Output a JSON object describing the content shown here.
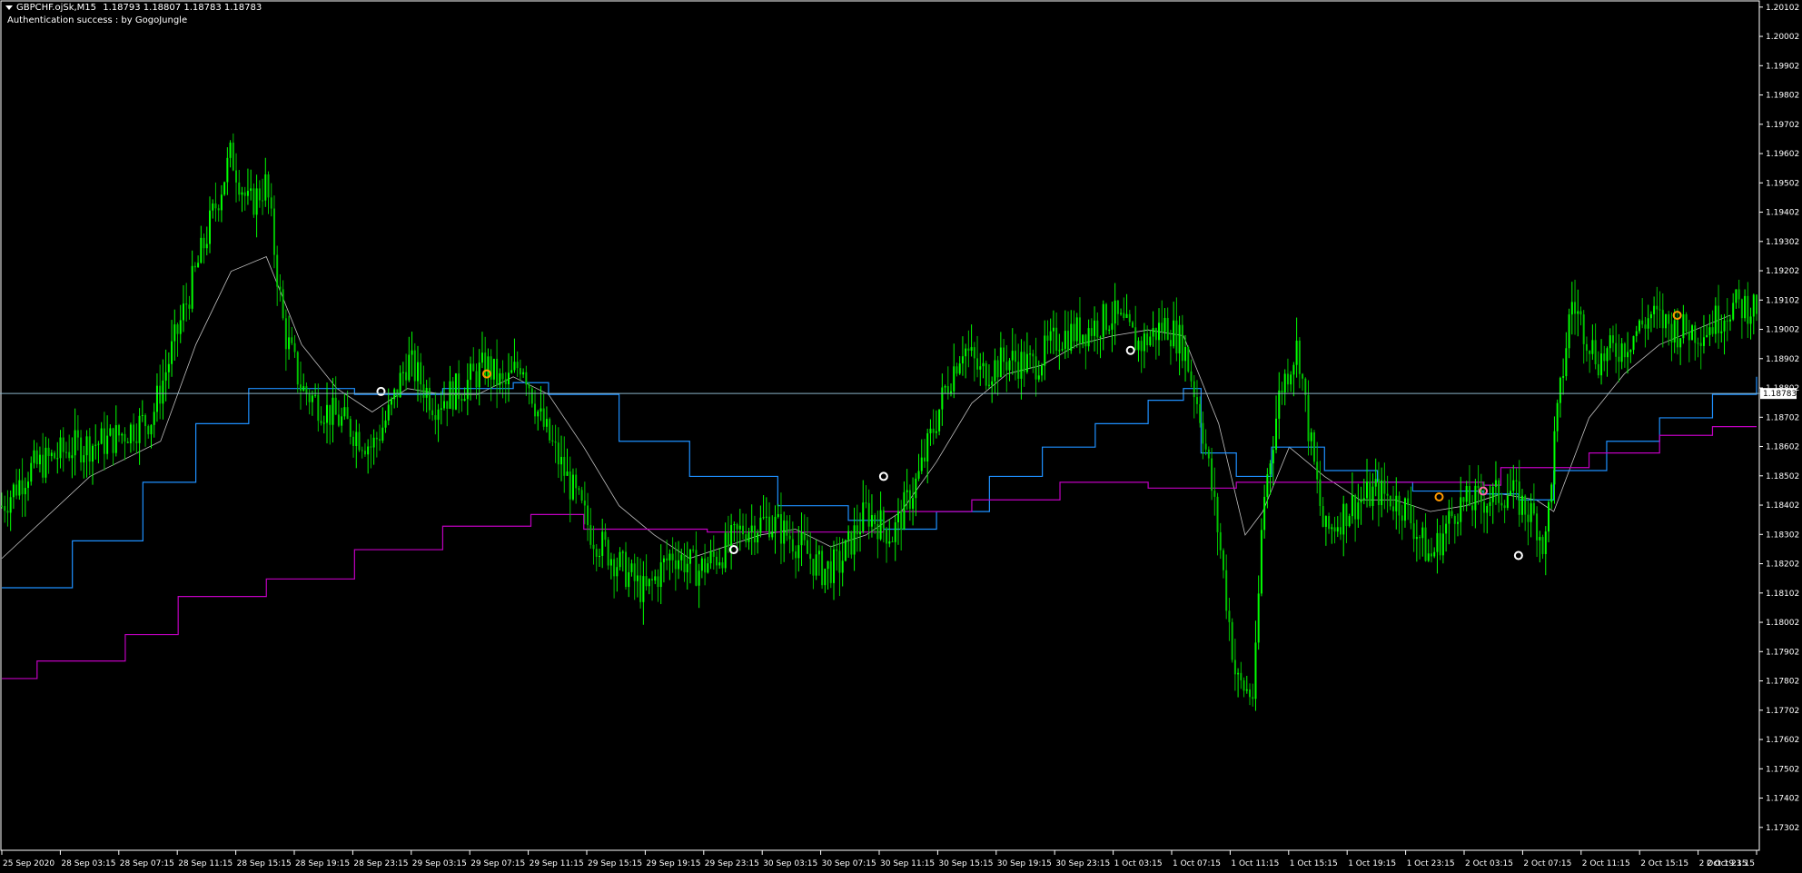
{
  "header": {
    "symbol_tf": "GBPCHF.ojSk,M15",
    "open": "1.18793",
    "high": "1.18807",
    "low": "1.18783",
    "close": "1.18783",
    "auth_message": "Authentication success : by GogoJungle"
  },
  "colors": {
    "background": "#000000",
    "axis": "#ffffff",
    "bull_candle": "#00ff00",
    "bear_candle": "#00c000",
    "ma_fast": "#c0c0c0",
    "ma_blue": "#1e90ff",
    "ma_magenta": "#c000c0",
    "bid_line": "#8ab4c8",
    "signal_white": "#ffffff",
    "signal_orange": "#ff9900",
    "signal_pink": "#ff66aa"
  },
  "chart_data": {
    "type": "candlestick",
    "title": "GBPCHF.ojSk,M15",
    "price_labels": [
      "1.20102",
      "1.20002",
      "1.19902",
      "1.19802",
      "1.19702",
      "1.19602",
      "1.19502",
      "1.19402",
      "1.19302",
      "1.19202",
      "1.19102",
      "1.19002",
      "1.18902",
      "1.18802",
      "1.18702",
      "1.18602",
      "1.18502",
      "1.18402",
      "1.18302",
      "1.18202",
      "1.18102",
      "1.18002",
      "1.17902",
      "1.17802",
      "1.17702",
      "1.17602",
      "1.17502",
      "1.17402",
      "1.17302"
    ],
    "ylim": [
      1.1723,
      1.2012
    ],
    "current_price": "1.18783",
    "time_labels": [
      "25 Sep 2020",
      "28 Sep 03:15",
      "28 Sep 07:15",
      "28 Sep 11:15",
      "28 Sep 15:15",
      "28 Sep 19:15",
      "28 Sep 23:15",
      "29 Sep 03:15",
      "29 Sep 07:15",
      "29 Sep 11:15",
      "29 Sep 15:15",
      "29 Sep 19:15",
      "29 Sep 23:15",
      "30 Sep 03:15",
      "30 Sep 07:15",
      "30 Sep 11:15",
      "30 Sep 15:15",
      "30 Sep 19:15",
      "30 Sep 23:15",
      "1 Oct 03:15",
      "1 Oct 07:15",
      "1 Oct 11:15",
      "1 Oct 15:15",
      "1 Oct 19:15",
      "1 Oct 23:15",
      "2 Oct 03:15",
      "2 Oct 07:15",
      "2 Oct 11:15",
      "2 Oct 15:15",
      "2 Oct 19:15",
      "2 Oct 23:15"
    ],
    "price_path": [
      [
        0,
        1.184
      ],
      [
        3,
        1.1852
      ],
      [
        8,
        1.186
      ],
      [
        12,
        1.1862
      ],
      [
        17,
        1.187
      ],
      [
        20,
        1.19
      ],
      [
        24,
        1.194
      ],
      [
        26,
        1.196
      ],
      [
        28,
        1.1942
      ],
      [
        30,
        1.195
      ],
      [
        32,
        1.19
      ],
      [
        34,
        1.188
      ],
      [
        37,
        1.1872
      ],
      [
        39,
        1.1868
      ],
      [
        42,
        1.186
      ],
      [
        44,
        1.1872
      ],
      [
        46,
        1.189
      ],
      [
        49,
        1.1875
      ],
      [
        52,
        1.188
      ],
      [
        55,
        1.1888
      ],
      [
        57,
        1.188
      ],
      [
        59,
        1.189
      ],
      [
        61,
        1.187
      ],
      [
        64,
        1.185
      ],
      [
        67,
        1.183
      ],
      [
        70,
        1.182
      ],
      [
        73,
        1.181
      ],
      [
        76,
        1.1824
      ],
      [
        79,
        1.1818
      ],
      [
        82,
        1.1825
      ],
      [
        84,
        1.1832
      ],
      [
        87,
        1.1835
      ],
      [
        90,
        1.1828
      ],
      [
        93,
        1.1818
      ],
      [
        95,
        1.182
      ],
      [
        98,
        1.1838
      ],
      [
        101,
        1.183
      ],
      [
        104,
        1.185
      ],
      [
        107,
        1.188
      ],
      [
        109,
        1.1895
      ],
      [
        111,
        1.1885
      ],
      [
        114,
        1.189
      ],
      [
        117,
        1.1888
      ],
      [
        120,
        1.1898
      ],
      [
        123,
        1.19
      ],
      [
        126,
        1.1905
      ],
      [
        129,
        1.1895
      ],
      [
        132,
        1.1902
      ],
      [
        134,
        1.1895
      ],
      [
        136,
        1.187
      ],
      [
        138,
        1.183
      ],
      [
        140,
        1.178
      ],
      [
        142,
        1.1775
      ],
      [
        143,
        1.184
      ],
      [
        145,
        1.188
      ],
      [
        147,
        1.1895
      ],
      [
        148,
        1.187
      ],
      [
        150,
        1.183
      ],
      [
        153,
        1.184
      ],
      [
        156,
        1.1845
      ],
      [
        159,
        1.184
      ],
      [
        162,
        1.1822
      ],
      [
        165,
        1.184
      ],
      [
        168,
        1.1842
      ],
      [
        171,
        1.1845
      ],
      [
        174,
        1.1835
      ],
      [
        175,
        1.1825
      ],
      [
        176,
        1.186
      ],
      [
        178,
        1.191
      ],
      [
        181,
        1.189
      ],
      [
        184,
        1.1895
      ],
      [
        187,
        1.1905
      ],
      [
        190,
        1.19
      ],
      [
        193,
        1.19
      ],
      [
        195,
        1.1905
      ],
      [
        196,
        1.1908
      ]
    ],
    "series": [
      {
        "name": "",
        "color": "#c0c0c0",
        "type": "line",
        "points": [
          [
            0,
            1.1822
          ],
          [
            10,
            1.185
          ],
          [
            18,
            1.1862
          ],
          [
            22,
            1.1895
          ],
          [
            26,
            1.192
          ],
          [
            30,
            1.1925
          ],
          [
            34,
            1.1895
          ],
          [
            38,
            1.188
          ],
          [
            42,
            1.1872
          ],
          [
            46,
            1.188
          ],
          [
            50,
            1.1878
          ],
          [
            54,
            1.1878
          ],
          [
            58,
            1.1884
          ],
          [
            62,
            1.1878
          ],
          [
            66,
            1.186
          ],
          [
            70,
            1.184
          ],
          [
            74,
            1.183
          ],
          [
            78,
            1.1822
          ],
          [
            82,
            1.1826
          ],
          [
            86,
            1.183
          ],
          [
            90,
            1.1832
          ],
          [
            94,
            1.1826
          ],
          [
            98,
            1.183
          ],
          [
            102,
            1.1838
          ],
          [
            106,
            1.1855
          ],
          [
            110,
            1.1875
          ],
          [
            114,
            1.1885
          ],
          [
            118,
            1.1888
          ],
          [
            122,
            1.1895
          ],
          [
            126,
            1.1898
          ],
          [
            130,
            1.19
          ],
          [
            134,
            1.1898
          ],
          [
            138,
            1.1868
          ],
          [
            141,
            1.183
          ],
          [
            143,
            1.1838
          ],
          [
            146,
            1.186
          ],
          [
            150,
            1.185
          ],
          [
            154,
            1.1842
          ],
          [
            158,
            1.1842
          ],
          [
            162,
            1.1838
          ],
          [
            166,
            1.184
          ],
          [
            170,
            1.1844
          ],
          [
            174,
            1.1842
          ],
          [
            176,
            1.1838
          ],
          [
            180,
            1.187
          ],
          [
            184,
            1.1885
          ],
          [
            188,
            1.1895
          ],
          [
            192,
            1.19
          ],
          [
            196,
            1.1905
          ]
        ]
      },
      {
        "name": "",
        "color": "#1e90ff",
        "type": "step",
        "points": [
          [
            0,
            1.1812
          ],
          [
            8,
            1.1828
          ],
          [
            16,
            1.1848
          ],
          [
            22,
            1.1868
          ],
          [
            28,
            1.188
          ],
          [
            40,
            1.1878
          ],
          [
            50,
            1.188
          ],
          [
            58,
            1.1882
          ],
          [
            62,
            1.1878
          ],
          [
            70,
            1.1862
          ],
          [
            78,
            1.185
          ],
          [
            88,
            1.184
          ],
          [
            96,
            1.1835
          ],
          [
            100,
            1.1832
          ],
          [
            106,
            1.1838
          ],
          [
            112,
            1.185
          ],
          [
            118,
            1.186
          ],
          [
            124,
            1.1868
          ],
          [
            130,
            1.1876
          ],
          [
            134,
            1.188
          ],
          [
            136,
            1.1858
          ],
          [
            140,
            1.185
          ],
          [
            144,
            1.186
          ],
          [
            150,
            1.1852
          ],
          [
            156,
            1.1848
          ],
          [
            160,
            1.1845
          ],
          [
            168,
            1.1844
          ],
          [
            172,
            1.1842
          ],
          [
            176,
            1.1852
          ],
          [
            182,
            1.1862
          ],
          [
            188,
            1.187
          ],
          [
            194,
            1.1878
          ],
          [
            199,
            1.1884
          ]
        ]
      },
      {
        "name": "",
        "color": "#c000c0",
        "type": "step",
        "points": [
          [
            0,
            1.1781
          ],
          [
            4,
            1.1787
          ],
          [
            14,
            1.1796
          ],
          [
            20,
            1.1809
          ],
          [
            30,
            1.1815
          ],
          [
            40,
            1.1825
          ],
          [
            50,
            1.1833
          ],
          [
            60,
            1.1837
          ],
          [
            66,
            1.1832
          ],
          [
            80,
            1.1831
          ],
          [
            100,
            1.1838
          ],
          [
            110,
            1.1842
          ],
          [
            120,
            1.1848
          ],
          [
            130,
            1.1846
          ],
          [
            140,
            1.1848
          ],
          [
            168,
            1.1847
          ],
          [
            170,
            1.1853
          ],
          [
            180,
            1.1858
          ],
          [
            188,
            1.1864
          ],
          [
            194,
            1.1867
          ],
          [
            199,
            1.1867
          ]
        ]
      }
    ],
    "signals": [
      {
        "x": 43,
        "price": 1.1879,
        "color": "#ffffff"
      },
      {
        "x": 55,
        "price": 1.1885,
        "color": "#ff9900"
      },
      {
        "x": 83,
        "price": 1.1825,
        "color": "#ffffff"
      },
      {
        "x": 100,
        "price": 1.185,
        "color": "#ffffff"
      },
      {
        "x": 128,
        "price": 1.1893,
        "color": "#ffffff"
      },
      {
        "x": 163,
        "price": 1.1843,
        "color": "#ff9900"
      },
      {
        "x": 168,
        "price": 1.1845,
        "color": "#ff66aa"
      },
      {
        "x": 172,
        "price": 1.1823,
        "color": "#ffffff"
      },
      {
        "x": 190,
        "price": 1.1905,
        "color": "#ff9900"
      }
    ],
    "xlim": [
      0,
      199
    ],
    "grid": false
  }
}
